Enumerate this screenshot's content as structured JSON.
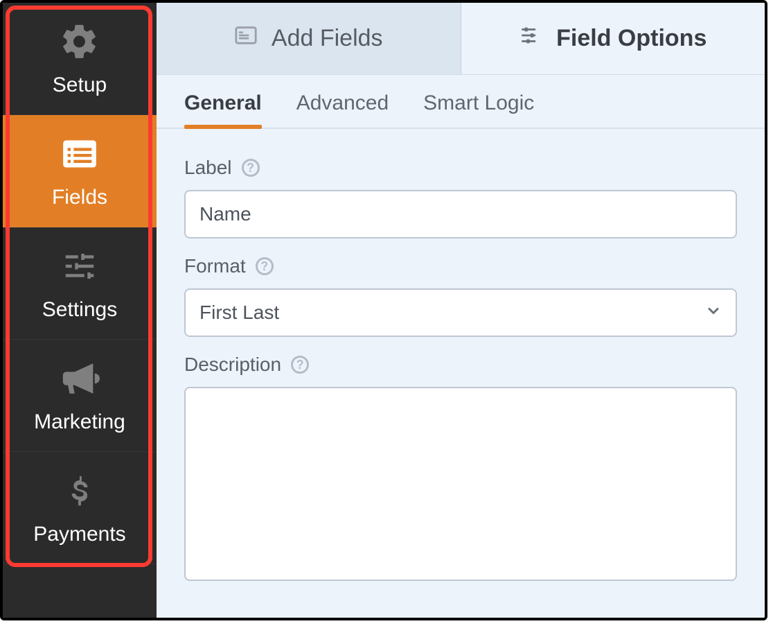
{
  "sidebar": {
    "items": [
      {
        "id": "setup",
        "label": "Setup",
        "active": false
      },
      {
        "id": "fields",
        "label": "Fields",
        "active": true
      },
      {
        "id": "settings",
        "label": "Settings",
        "active": false
      },
      {
        "id": "marketing",
        "label": "Marketing",
        "active": false
      },
      {
        "id": "payments",
        "label": "Payments",
        "active": false
      }
    ]
  },
  "top_tabs": {
    "add_fields": "Add Fields",
    "field_options": "Field Options",
    "active": "field_options"
  },
  "sub_tabs": {
    "general": "General",
    "advanced": "Advanced",
    "smart_logic": "Smart Logic",
    "active": "general"
  },
  "form": {
    "label_field": {
      "label": "Label",
      "value": "Name"
    },
    "format_field": {
      "label": "Format",
      "value": "First Last"
    },
    "description_field": {
      "label": "Description",
      "value": ""
    }
  }
}
